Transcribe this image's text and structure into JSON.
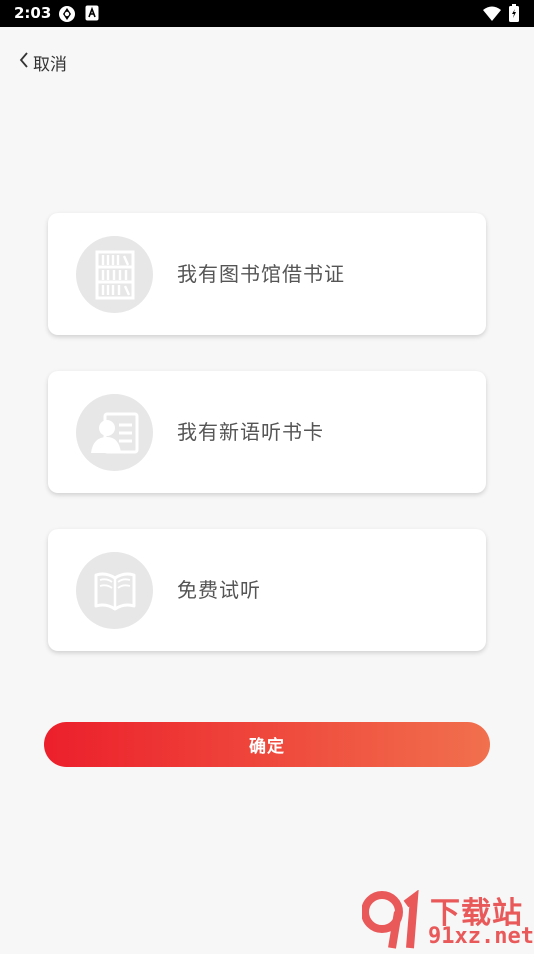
{
  "status_bar": {
    "time": "2:03",
    "icons": [
      "app-notification-icon",
      "a-notification-icon",
      "wifi-icon",
      "battery-icon"
    ]
  },
  "nav": {
    "cancel_label": "取消",
    "back_icon": "chevron-left-icon"
  },
  "options": [
    {
      "label": "我有图书馆借书证",
      "icon": "bookshelf-icon"
    },
    {
      "label": "我有新语听书卡",
      "icon": "id-card-icon"
    },
    {
      "label": "免费试听",
      "icon": "open-book-icon"
    }
  ],
  "confirm_label": "确定",
  "watermark": {
    "top": "下载站",
    "bottom": "91xz.net"
  },
  "colors": {
    "background": "#f7f7f7",
    "gradient_start": "#ec1f2b",
    "gradient_end": "#f1704d",
    "icon_bg": "#e7e7e7"
  }
}
